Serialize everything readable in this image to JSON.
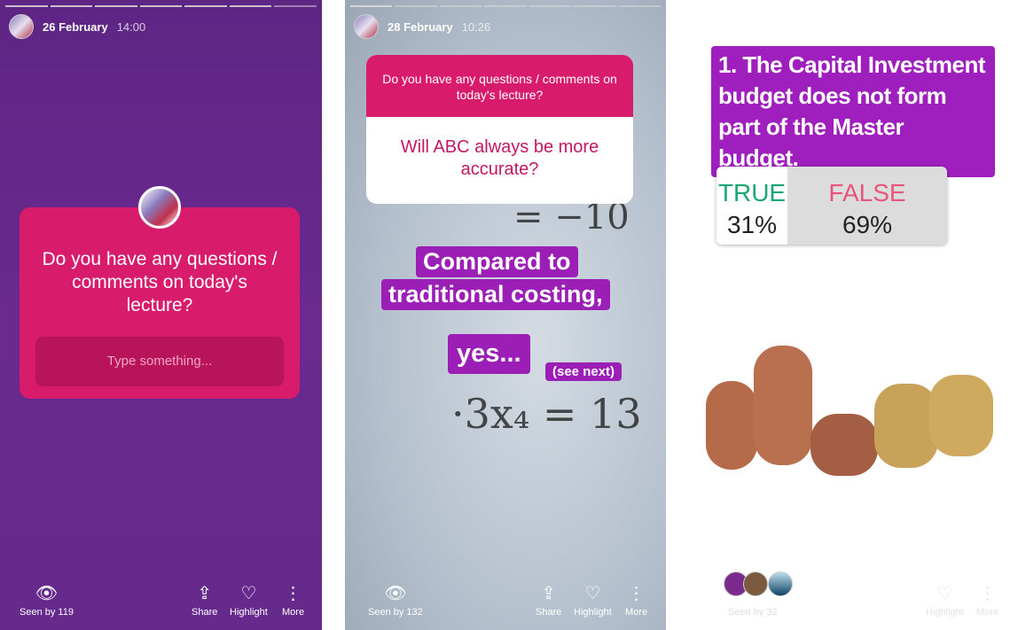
{
  "stories": [
    {
      "date": "26 February",
      "time": "14:00",
      "question": "Do you have any questions / comments on today's lecture?",
      "input_placeholder": "Type something...",
      "seen": "Seen by 119",
      "share": "Share",
      "highlight": "Highlight",
      "more": "More"
    },
    {
      "date": "28 February",
      "time": "10:26",
      "question": "Do you have any questions / comments on today's lecture?",
      "answer": "Will ABC always be more accurate?",
      "text1": "Compared to",
      "text2": "traditional costing,",
      "text3": "yes...",
      "text4": "(see next)",
      "math1": "= −10",
      "math2": "·3x₄ = 13",
      "seen": "Seen by 132",
      "share": "Share",
      "highlight": "Highlight",
      "more": "More"
    },
    {
      "quiz": "1. The Capital Investment budget does not form part of the Master budget.",
      "true_label": "TRUE",
      "true_pct": "31%",
      "false_label": "FALSE",
      "false_pct": "69%",
      "seen": "Seen by 32",
      "highlight": "Highlight",
      "more": "More"
    }
  ],
  "colors": {
    "purple_bg": "#6a2a8e",
    "question_pink": "#d81b6b",
    "label_purple": "#9b1fb6",
    "true_green": "#1ba672",
    "false_pink": "#e8557a"
  },
  "icons": {
    "seen": "eye-icon",
    "share": "share-icon",
    "highlight": "heart-circle-icon",
    "more": "more-vertical-icon"
  }
}
